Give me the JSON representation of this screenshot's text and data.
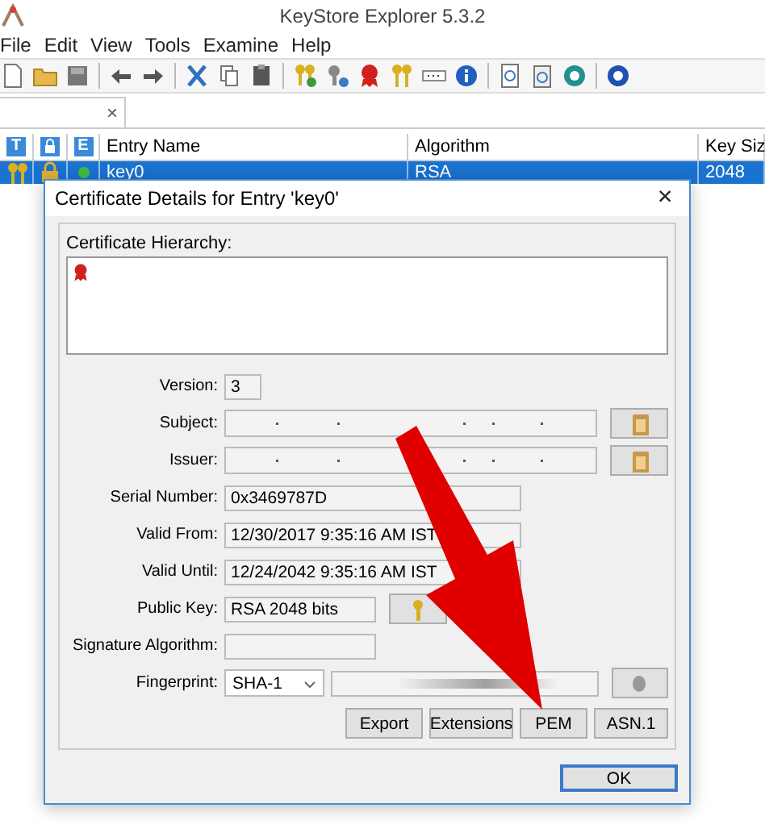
{
  "window": {
    "title": "KeyStore Explorer 5.3.2"
  },
  "menu": [
    "File",
    "Edit",
    "View",
    "Tools",
    "Examine",
    "Help"
  ],
  "tabs": [
    {
      "label": "×",
      "selected": true
    }
  ],
  "table": {
    "columns": [
      "T",
      "E",
      "Entry Name",
      "Algorithm",
      "Key Siz"
    ],
    "rows": [
      {
        "entry_name": "key0",
        "algorithm": "RSA",
        "key_size": "2048",
        "selected": true
      }
    ]
  },
  "dialog": {
    "title": "Certificate Details for Entry 'key0'",
    "close": "×",
    "hierarchy_label": "Certificate Hierarchy:",
    "fields": [
      {
        "kind": "short",
        "label": "Version:",
        "value": "3"
      },
      {
        "kind": "redacted",
        "label": "Subject:"
      },
      {
        "kind": "redacted",
        "label": "Issuer:"
      },
      {
        "kind": "text",
        "label": "Serial Number:",
        "value": "0x3469787D"
      },
      {
        "kind": "text",
        "label": "Valid From:",
        "value": "12/30/2017 9:35:16 AM IST"
      },
      {
        "kind": "text",
        "label": "Valid Until:",
        "value": "12/24/2042 9:35:16 AM IST"
      },
      {
        "kind": "key",
        "label": "Public Key:",
        "value": "RSA 2048 bits"
      },
      {
        "kind": "empty",
        "label": "Signature Algorithm:"
      },
      {
        "kind": "fingerprint",
        "label": "Fingerprint:",
        "value": "SHA-1"
      }
    ],
    "buttons": [
      "Export",
      "Extensions",
      "PEM",
      "ASN.1"
    ],
    "ok": "OK"
  }
}
